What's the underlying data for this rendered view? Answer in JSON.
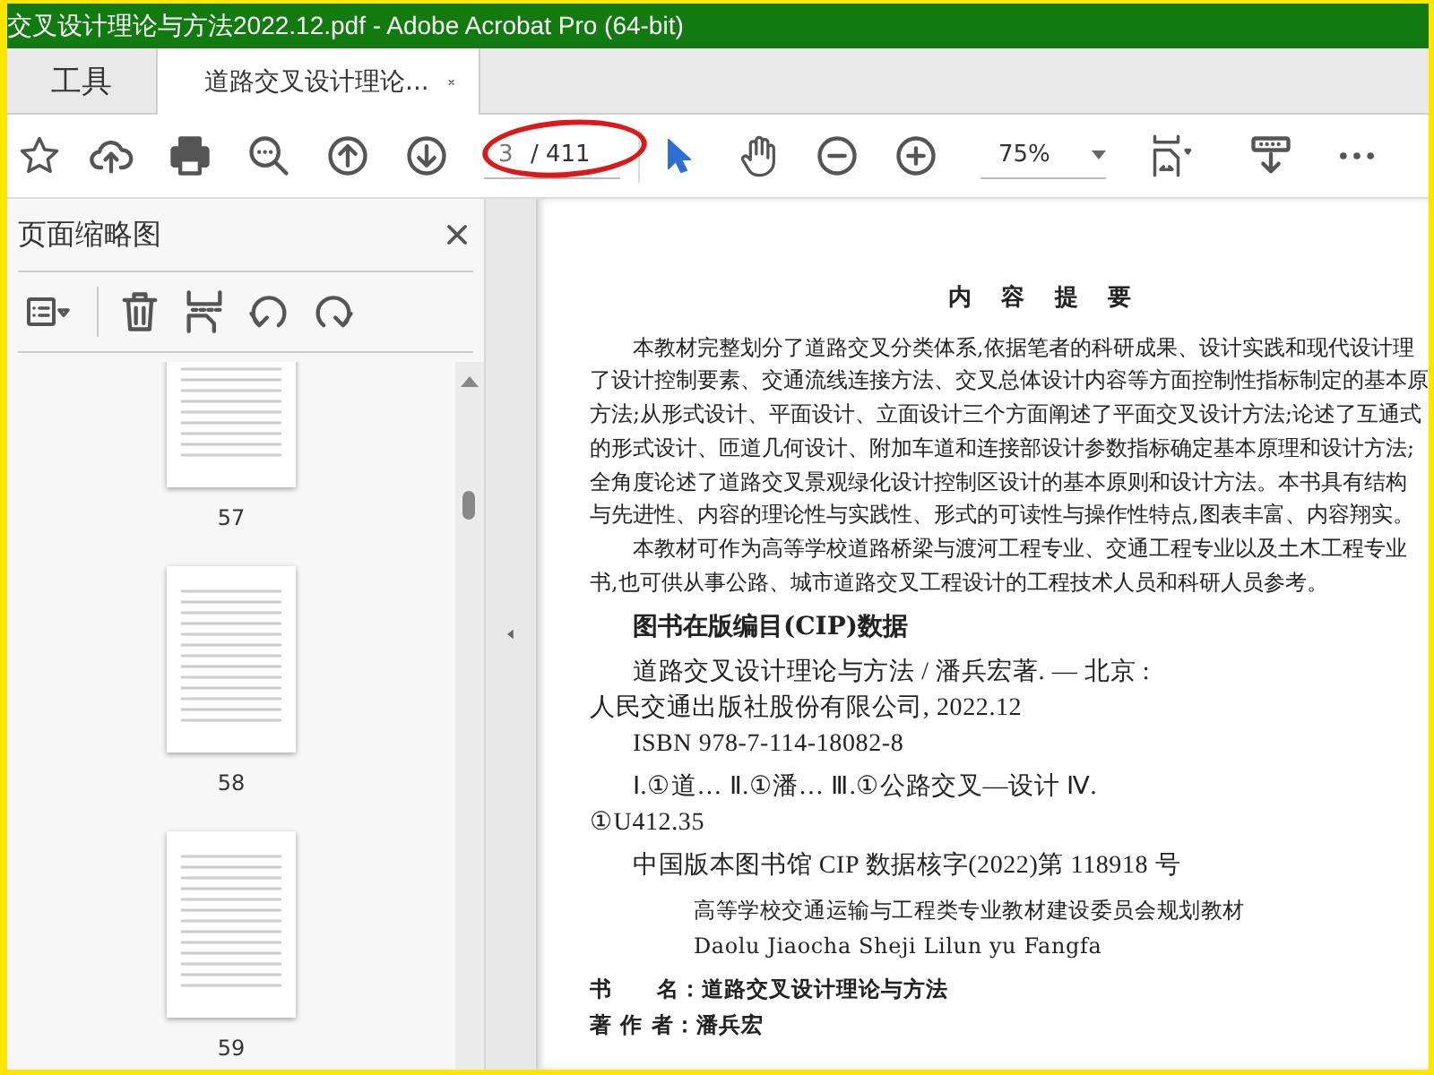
{
  "window": {
    "title": "交叉设计理论与方法2022.12.pdf - Adobe Acrobat Pro (64-bit)"
  },
  "tabs": [
    {
      "label": "工具",
      "selected": false
    },
    {
      "label": "道路交叉设计理论...",
      "selected": true
    }
  ],
  "toolbar": {
    "page": {
      "value": "3",
      "total": "/ 411"
    },
    "zoom": {
      "value": "75%"
    }
  },
  "sidebar": {
    "title": "页面缩略图",
    "thumbnails": [
      {
        "label": "57"
      },
      {
        "label": "58"
      },
      {
        "label": "59"
      }
    ]
  },
  "document": {
    "blocks": [
      {
        "kind": "heading",
        "lines": [
          {
            "text": "内 容 提 要"
          }
        ]
      },
      {
        "kind": "abstract",
        "lines": [
          {
            "text": "本教材完整划分了道路交叉分类体系,依据笔者的科研成果、设计实践和现代设计理",
            "indent": true
          },
          {
            "text": "了设计控制要素、交通流线连接方法、交叉总体设计内容等方面控制性指标制定的基本原",
            "indent": false
          },
          {
            "text": "方法;从形式设计、平面设计、立面设计三个方面阐述了平面交叉设计方法;论述了互通式",
            "indent": false
          },
          {
            "text": "的形式设计、匝道几何设计、附加车道和连接部设计参数指标确定基本原理和设计方法;",
            "indent": false
          },
          {
            "text": "全角度论述了道路交叉景观绿化设计控制区设计的基本原则和设计方法。本书具有结构",
            "indent": false
          },
          {
            "text": "与先进性、内容的理论性与实践性、形式的可读性与操作性特点,图表丰富、内容翔实。",
            "indent": false
          },
          {
            "text": "本教材可作为高等学校道路桥梁与渡河工程专业、交通工程专业以及土木工程专业",
            "indent": true
          },
          {
            "text": "书,也可供从事公路、城市道路交叉工程设计的工程技术人员和科研人员参考。",
            "indent": false
          }
        ]
      },
      {
        "kind": "cip-title",
        "lines": [
          {
            "text": "图书在版编目(CIP)数据",
            "indent": true
          }
        ]
      },
      {
        "kind": "cip",
        "lines": [
          {
            "text": "道路交叉设计理论与方法 / 潘兵宏著. — 北京 :",
            "indent": true
          },
          {
            "text": "人民交通出版社股份有限公司, 2022.12",
            "indent": false
          },
          {
            "text": "ISBN  978-7-114-18082-8",
            "indent": true
          }
        ]
      },
      {
        "kind": "cip",
        "lines": [
          {
            "text": "Ⅰ.①道…   Ⅱ.①潘…   Ⅲ.①公路交叉—设计   Ⅳ.",
            "indent": true
          },
          {
            "text": "①U412.35",
            "indent": false
          }
        ]
      },
      {
        "kind": "cip",
        "lines": [
          {
            "text": "中国版本图书馆 CIP 数据核字(2022)第 118918 号",
            "indent": true
          }
        ]
      },
      {
        "kind": "series",
        "lines": [
          {
            "text": "高等学校交通运输与工程类专业教材建设委员会规划教材",
            "indent": true
          },
          {
            "text": "Daolu Jiaocha Sheji Lilun yu Fangfa",
            "indent": true
          }
        ]
      },
      {
        "kind": "credits",
        "lines": [
          {
            "text": "书　　名：道路交叉设计理论与方法",
            "indent": false
          },
          {
            "text": "著 作 者：潘兵宏",
            "indent": false
          }
        ]
      }
    ]
  }
}
